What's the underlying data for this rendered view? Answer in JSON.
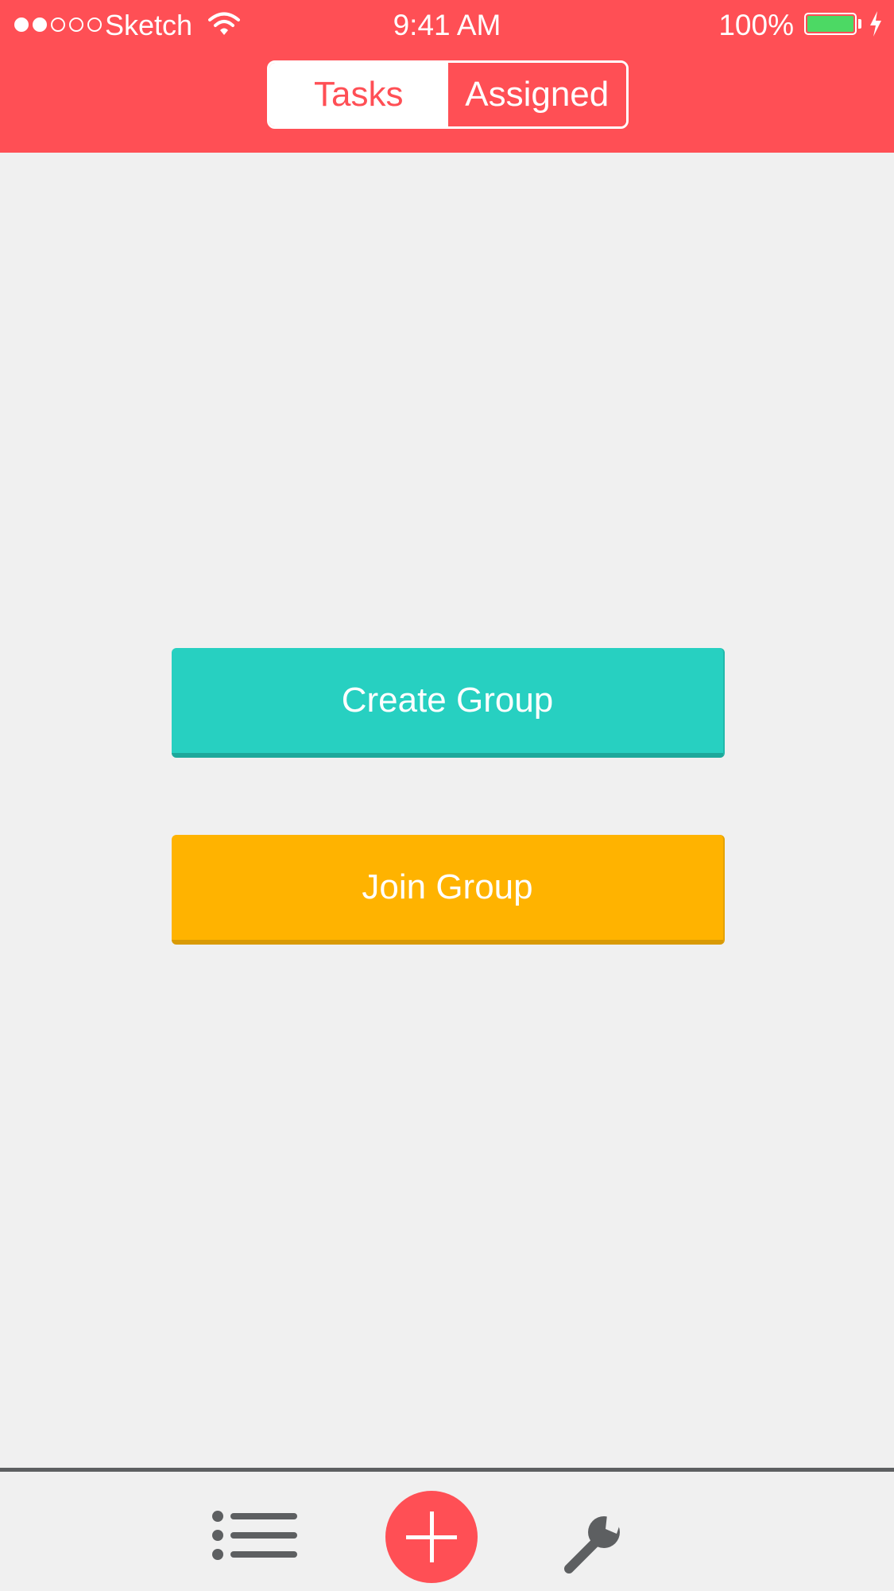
{
  "status_bar": {
    "carrier": "Sketch",
    "time": "9:41 AM",
    "battery": "100%",
    "signal_strength": 2,
    "signal_max": 5,
    "battery_level": 1.0,
    "icons": [
      "signal-dots-icon",
      "wifi-icon",
      "battery-icon",
      "charging-bolt-icon"
    ]
  },
  "header": {
    "tabs": [
      {
        "label": "Tasks",
        "active": true
      },
      {
        "label": "Assigned",
        "active": false
      }
    ]
  },
  "main": {
    "create_group_label": "Create Group",
    "join_group_label": "Join Group"
  },
  "tab_bar": {
    "items": [
      {
        "icon": "list-icon"
      },
      {
        "icon": "plus-icon"
      },
      {
        "icon": "wrench-icon"
      }
    ]
  },
  "colors": {
    "brand": "#ff4f55",
    "create_button": "#27d0c1",
    "join_button": "#ffb300",
    "background": "#f0f0f0",
    "tab_icon": "#5d5f61",
    "battery_fill": "#4cd964"
  }
}
